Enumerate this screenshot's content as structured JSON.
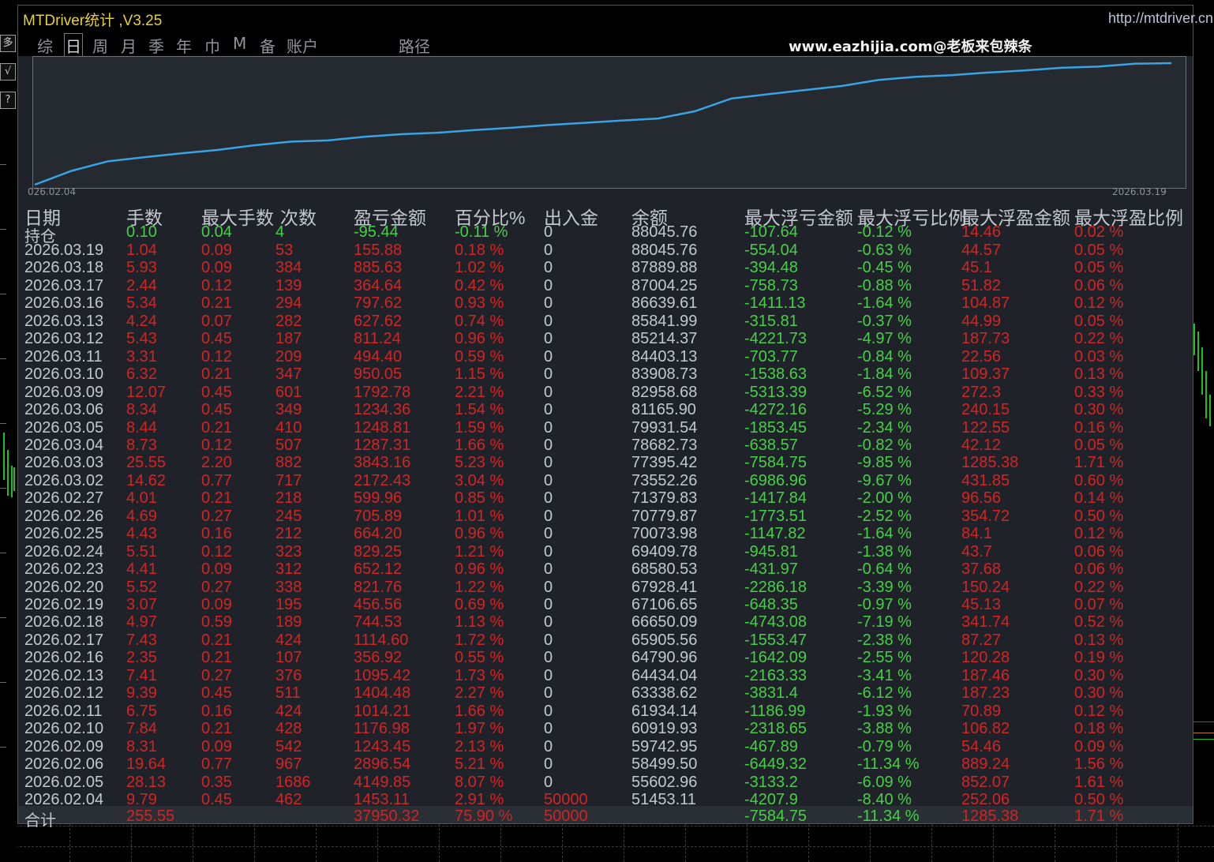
{
  "app": {
    "title": "MTDriver统计 ,V3.25",
    "link": "http://mtdriver.cn"
  },
  "watermark": "www.eazhijia.com@老板来包辣条",
  "side_buttons": [
    "多",
    "√",
    "?"
  ],
  "tabs": [
    {
      "label": "综",
      "active": false
    },
    {
      "label": "日",
      "active": true
    },
    {
      "label": "周",
      "active": false
    },
    {
      "label": "月",
      "active": false
    },
    {
      "label": "季",
      "active": false
    },
    {
      "label": "年",
      "active": false
    },
    {
      "label": "巾",
      "active": false
    },
    {
      "label": "M",
      "active": false
    },
    {
      "label": "备",
      "active": false
    },
    {
      "label": "账户",
      "active": false
    },
    {
      "label": "路径",
      "active": false
    }
  ],
  "chart_data": {
    "type": "line",
    "x_start_label": "026.02.04",
    "x_end_label": "2026.03.19",
    "color": "#3aa3e3",
    "x": [
      "2026.02.04",
      "2026.02.05",
      "2026.02.06",
      "2026.02.09",
      "2026.02.10",
      "2026.02.11",
      "2026.02.12",
      "2026.02.13",
      "2026.02.16",
      "2026.02.17",
      "2026.02.18",
      "2026.02.19",
      "2026.02.20",
      "2026.02.23",
      "2026.02.24",
      "2026.02.25",
      "2026.02.26",
      "2026.02.27",
      "2026.03.02",
      "2026.03.03",
      "2026.03.04",
      "2026.03.05",
      "2026.03.06",
      "2026.03.09",
      "2026.03.10",
      "2026.03.11",
      "2026.03.12",
      "2026.03.13",
      "2026.03.16",
      "2026.03.17",
      "2026.03.18",
      "2026.03.19"
    ],
    "y": [
      51453.11,
      55602.96,
      58499.5,
      59742.95,
      60919.93,
      61934.14,
      63338.62,
      64434.04,
      64790.96,
      65905.56,
      66650.09,
      67106.65,
      67928.41,
      68580.53,
      69409.78,
      70073.98,
      70779.87,
      71379.83,
      73552.26,
      77395.42,
      78682.73,
      79931.54,
      81165.9,
      82958.68,
      83908.73,
      84403.13,
      85214.37,
      85841.99,
      86639.61,
      87004.25,
      87889.88,
      88045.76
    ]
  },
  "table": {
    "headers": [
      "日期",
      "手数",
      "最大手数",
      "次数",
      "盈亏金额",
      "百分比%",
      "出入金",
      "余额",
      "最大浮亏金额",
      "最大浮亏比例",
      "最大浮盈金额",
      "最大浮盈比例"
    ],
    "holding": [
      "持仓",
      "0.10",
      "0.04",
      "4",
      "-95.44",
      "-0.11 %",
      "0",
      "88045.76",
      "-107.64",
      "-0.12 %",
      "14.46",
      "0.02 %"
    ],
    "rows": [
      [
        "2026.03.19",
        "1.04",
        "0.09",
        "53",
        "155.88",
        "0.18 %",
        "0",
        "88045.76",
        "-554.04",
        "-0.63 %",
        "44.57",
        "0.05 %"
      ],
      [
        "2026.03.18",
        "5.93",
        "0.09",
        "384",
        "885.63",
        "1.02 %",
        "0",
        "87889.88",
        "-394.48",
        "-0.45 %",
        "45.1",
        "0.05 %"
      ],
      [
        "2026.03.17",
        "2.44",
        "0.12",
        "139",
        "364.64",
        "0.42 %",
        "0",
        "87004.25",
        "-758.73",
        "-0.88 %",
        "51.82",
        "0.06 %"
      ],
      [
        "2026.03.16",
        "5.34",
        "0.21",
        "294",
        "797.62",
        "0.93 %",
        "0",
        "86639.61",
        "-1411.13",
        "-1.64 %",
        "104.87",
        "0.12 %"
      ],
      [
        "2026.03.13",
        "4.24",
        "0.07",
        "282",
        "627.62",
        "0.74 %",
        "0",
        "85841.99",
        "-315.81",
        "-0.37 %",
        "44.99",
        "0.05 %"
      ],
      [
        "2026.03.12",
        "5.43",
        "0.45",
        "187",
        "811.24",
        "0.96 %",
        "0",
        "85214.37",
        "-4221.73",
        "-4.97 %",
        "187.73",
        "0.22 %"
      ],
      [
        "2026.03.11",
        "3.31",
        "0.12",
        "209",
        "494.40",
        "0.59 %",
        "0",
        "84403.13",
        "-703.77",
        "-0.84 %",
        "22.56",
        "0.03 %"
      ],
      [
        "2026.03.10",
        "6.32",
        "0.21",
        "347",
        "950.05",
        "1.15 %",
        "0",
        "83908.73",
        "-1538.63",
        "-1.84 %",
        "109.37",
        "0.13 %"
      ],
      [
        "2026.03.09",
        "12.07",
        "0.45",
        "601",
        "1792.78",
        "2.21 %",
        "0",
        "82958.68",
        "-5313.39",
        "-6.52 %",
        "272.3",
        "0.33 %"
      ],
      [
        "2026.03.06",
        "8.34",
        "0.45",
        "349",
        "1234.36",
        "1.54 %",
        "0",
        "81165.90",
        "-4272.16",
        "-5.29 %",
        "240.15",
        "0.30 %"
      ],
      [
        "2026.03.05",
        "8.44",
        "0.21",
        "410",
        "1248.81",
        "1.59 %",
        "0",
        "79931.54",
        "-1853.45",
        "-2.34 %",
        "122.55",
        "0.16 %"
      ],
      [
        "2026.03.04",
        "8.73",
        "0.12",
        "507",
        "1287.31",
        "1.66 %",
        "0",
        "78682.73",
        "-638.57",
        "-0.82 %",
        "42.12",
        "0.05 %"
      ],
      [
        "2026.03.03",
        "25.55",
        "2.20",
        "882",
        "3843.16",
        "5.23 %",
        "0",
        "77395.42",
        "-7584.75",
        "-9.85 %",
        "1285.38",
        "1.71 %"
      ],
      [
        "2026.03.02",
        "14.62",
        "0.77",
        "717",
        "2172.43",
        "3.04 %",
        "0",
        "73552.26",
        "-6986.96",
        "-9.67 %",
        "431.85",
        "0.60 %"
      ],
      [
        "2026.02.27",
        "4.01",
        "0.21",
        "218",
        "599.96",
        "0.85 %",
        "0",
        "71379.83",
        "-1417.84",
        "-2.00 %",
        "96.56",
        "0.14 %"
      ],
      [
        "2026.02.26",
        "4.69",
        "0.27",
        "245",
        "705.89",
        "1.01 %",
        "0",
        "70779.87",
        "-1773.51",
        "-2.52 %",
        "354.72",
        "0.50 %"
      ],
      [
        "2026.02.25",
        "4.43",
        "0.16",
        "212",
        "664.20",
        "0.96 %",
        "0",
        "70073.98",
        "-1147.82",
        "-1.64 %",
        "84.1",
        "0.12 %"
      ],
      [
        "2026.02.24",
        "5.51",
        "0.12",
        "323",
        "829.25",
        "1.21 %",
        "0",
        "69409.78",
        "-945.81",
        "-1.38 %",
        "43.7",
        "0.06 %"
      ],
      [
        "2026.02.23",
        "4.41",
        "0.09",
        "312",
        "652.12",
        "0.96 %",
        "0",
        "68580.53",
        "-431.97",
        "-0.64 %",
        "37.68",
        "0.06 %"
      ],
      [
        "2026.02.20",
        "5.52",
        "0.27",
        "338",
        "821.76",
        "1.22 %",
        "0",
        "67928.41",
        "-2286.18",
        "-3.39 %",
        "150.24",
        "0.22 %"
      ],
      [
        "2026.02.19",
        "3.07",
        "0.09",
        "195",
        "456.56",
        "0.69 %",
        "0",
        "67106.65",
        "-648.35",
        "-0.97 %",
        "45.13",
        "0.07 %"
      ],
      [
        "2026.02.18",
        "4.97",
        "0.59",
        "189",
        "744.53",
        "1.13 %",
        "0",
        "66650.09",
        "-4743.08",
        "-7.19 %",
        "341.74",
        "0.52 %"
      ],
      [
        "2026.02.17",
        "7.43",
        "0.21",
        "424",
        "1114.60",
        "1.72 %",
        "0",
        "65905.56",
        "-1553.47",
        "-2.38 %",
        "87.27",
        "0.13 %"
      ],
      [
        "2026.02.16",
        "2.35",
        "0.21",
        "107",
        "356.92",
        "0.55 %",
        "0",
        "64790.96",
        "-1642.09",
        "-2.55 %",
        "120.28",
        "0.19 %"
      ],
      [
        "2026.02.13",
        "7.41",
        "0.27",
        "376",
        "1095.42",
        "1.73 %",
        "0",
        "64434.04",
        "-2163.33",
        "-3.41 %",
        "187.46",
        "0.30 %"
      ],
      [
        "2026.02.12",
        "9.39",
        "0.45",
        "511",
        "1404.48",
        "2.27 %",
        "0",
        "63338.62",
        "-3831.4",
        "-6.12 %",
        "187.23",
        "0.30 %"
      ],
      [
        "2026.02.11",
        "6.75",
        "0.16",
        "424",
        "1014.21",
        "1.66 %",
        "0",
        "61934.14",
        "-1186.99",
        "-1.93 %",
        "70.89",
        "0.12 %"
      ],
      [
        "2026.02.10",
        "7.84",
        "0.21",
        "428",
        "1176.98",
        "1.97 %",
        "0",
        "60919.93",
        "-2318.65",
        "-3.88 %",
        "106.82",
        "0.18 %"
      ],
      [
        "2026.02.09",
        "8.31",
        "0.09",
        "542",
        "1243.45",
        "2.13 %",
        "0",
        "59742.95",
        "-467.89",
        "-0.79 %",
        "54.46",
        "0.09 %"
      ],
      [
        "2026.02.06",
        "19.64",
        "0.77",
        "967",
        "2896.54",
        "5.21 %",
        "0",
        "58499.50",
        "-6449.32",
        "-11.34 %",
        "889.24",
        "1.56 %"
      ],
      [
        "2026.02.05",
        "28.13",
        "0.35",
        "1686",
        "4149.85",
        "8.07 %",
        "0",
        "55602.96",
        "-3133.2",
        "-6.09 %",
        "852.07",
        "1.61 %"
      ],
      [
        "2026.02.04",
        "9.79",
        "0.45",
        "462",
        "1453.11",
        "2.91 %",
        "50000",
        "51453.11",
        "-4207.9",
        "-8.40 %",
        "252.06",
        "0.50 %"
      ]
    ],
    "total": [
      "合计",
      "255.55",
      "",
      "",
      "37950.32",
      "75.90 %",
      "50000",
      "",
      "-7584.75",
      "-11.34 %",
      "1285.38",
      "1.71 %"
    ]
  },
  "colors": {
    "date": "#c3c8d0",
    "holding_green": "#45d045",
    "red": "#d42424",
    "green": "#45d045",
    "neutral": "#c3c8d0"
  }
}
